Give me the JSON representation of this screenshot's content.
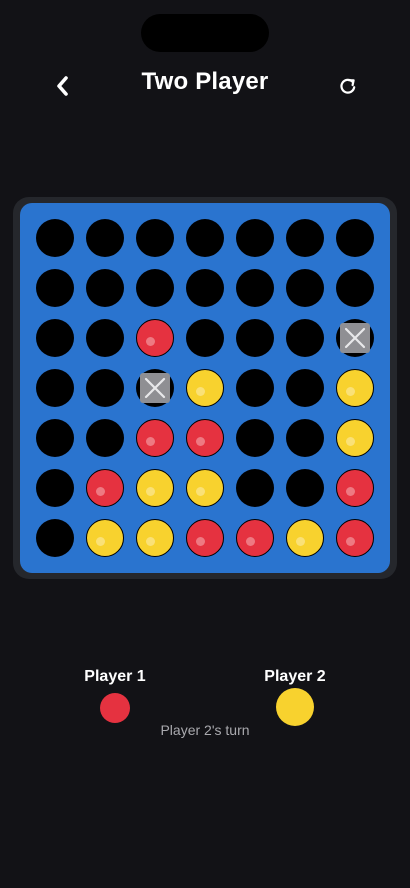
{
  "header": {
    "title": "Two Player",
    "back_icon": "chevron-left-icon",
    "restart_icon": "restart-icon"
  },
  "colors": {
    "background": "#121216",
    "board": "#2a74cf",
    "red": "#e53240",
    "yellow": "#f8d22e",
    "empty": "#000000",
    "blocked": "#8f8f93"
  },
  "board": {
    "columns": 7,
    "rows": 7,
    "cells": [
      [
        "empty",
        "empty",
        "empty",
        "empty",
        "empty",
        "empty",
        "empty"
      ],
      [
        "empty",
        "empty",
        "empty",
        "empty",
        "empty",
        "empty",
        "empty"
      ],
      [
        "empty",
        "empty",
        "red",
        "empty",
        "empty",
        "empty",
        "blocked"
      ],
      [
        "empty",
        "empty",
        "blocked",
        "yellow",
        "empty",
        "empty",
        "yellow"
      ],
      [
        "empty",
        "empty",
        "red",
        "red",
        "empty",
        "empty",
        "yellow"
      ],
      [
        "empty",
        "red",
        "yellow",
        "yellow",
        "empty",
        "empty",
        "red"
      ],
      [
        "empty",
        "yellow",
        "yellow",
        "red",
        "red",
        "yellow",
        "red"
      ]
    ]
  },
  "players": {
    "p1": {
      "label": "Player 1",
      "color": "#e53240"
    },
    "p2": {
      "label": "Player 2",
      "color": "#f8d22e"
    },
    "turn_text": "Player 2's turn"
  }
}
